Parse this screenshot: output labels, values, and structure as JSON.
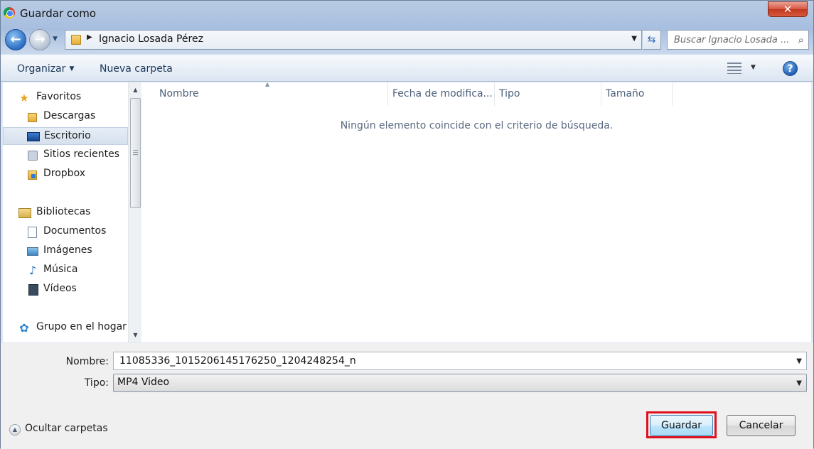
{
  "window": {
    "title": "Guardar como",
    "close_symbol": "✕"
  },
  "address": {
    "back_symbol": "⮌",
    "breadcrumb_path": "Ignacio Losada Pérez",
    "search_placeholder": "Buscar Ignacio Losada ...",
    "icons": [
      "back-icon",
      "forward-icon",
      "folder-icon",
      "refresh-icon",
      "search-icon"
    ]
  },
  "toolbar": {
    "organize_label": "Organizar",
    "new_folder_label": "Nueva carpeta",
    "help_symbol": "?"
  },
  "nav": {
    "favorites": {
      "label": "Favoritos",
      "items": [
        {
          "label": "Descargas",
          "icon": "downloads-folder-icon"
        },
        {
          "label": "Escritorio",
          "icon": "desktop-icon",
          "selected": true
        },
        {
          "label": "Sitios recientes",
          "icon": "recent-places-icon"
        },
        {
          "label": "Dropbox",
          "icon": "dropbox-folder-icon"
        }
      ]
    },
    "libraries": {
      "label": "Bibliotecas",
      "items": [
        {
          "label": "Documentos",
          "icon": "documents-icon"
        },
        {
          "label": "Imágenes",
          "icon": "pictures-icon"
        },
        {
          "label": "Música",
          "icon": "music-icon"
        },
        {
          "label": "Vídeos",
          "icon": "videos-icon"
        }
      ]
    },
    "homegroup": {
      "label": "Grupo en el hogar"
    }
  },
  "content": {
    "columns": [
      "Nombre",
      "Fecha de modifica...",
      "Tipo",
      "Tamaño"
    ],
    "empty_message": "Ningún elemento coincide con el criterio de búsqueda."
  },
  "form": {
    "name_label": "Nombre:",
    "name_value": "11085336_1015206145176250_1204248254_n",
    "type_label": "Tipo:",
    "type_value": "MP4 Video"
  },
  "footer": {
    "hide_folders_label": "Ocultar carpetas",
    "save_label": "Guardar",
    "cancel_label": "Cancelar",
    "highlight_color": "#e0101e"
  }
}
